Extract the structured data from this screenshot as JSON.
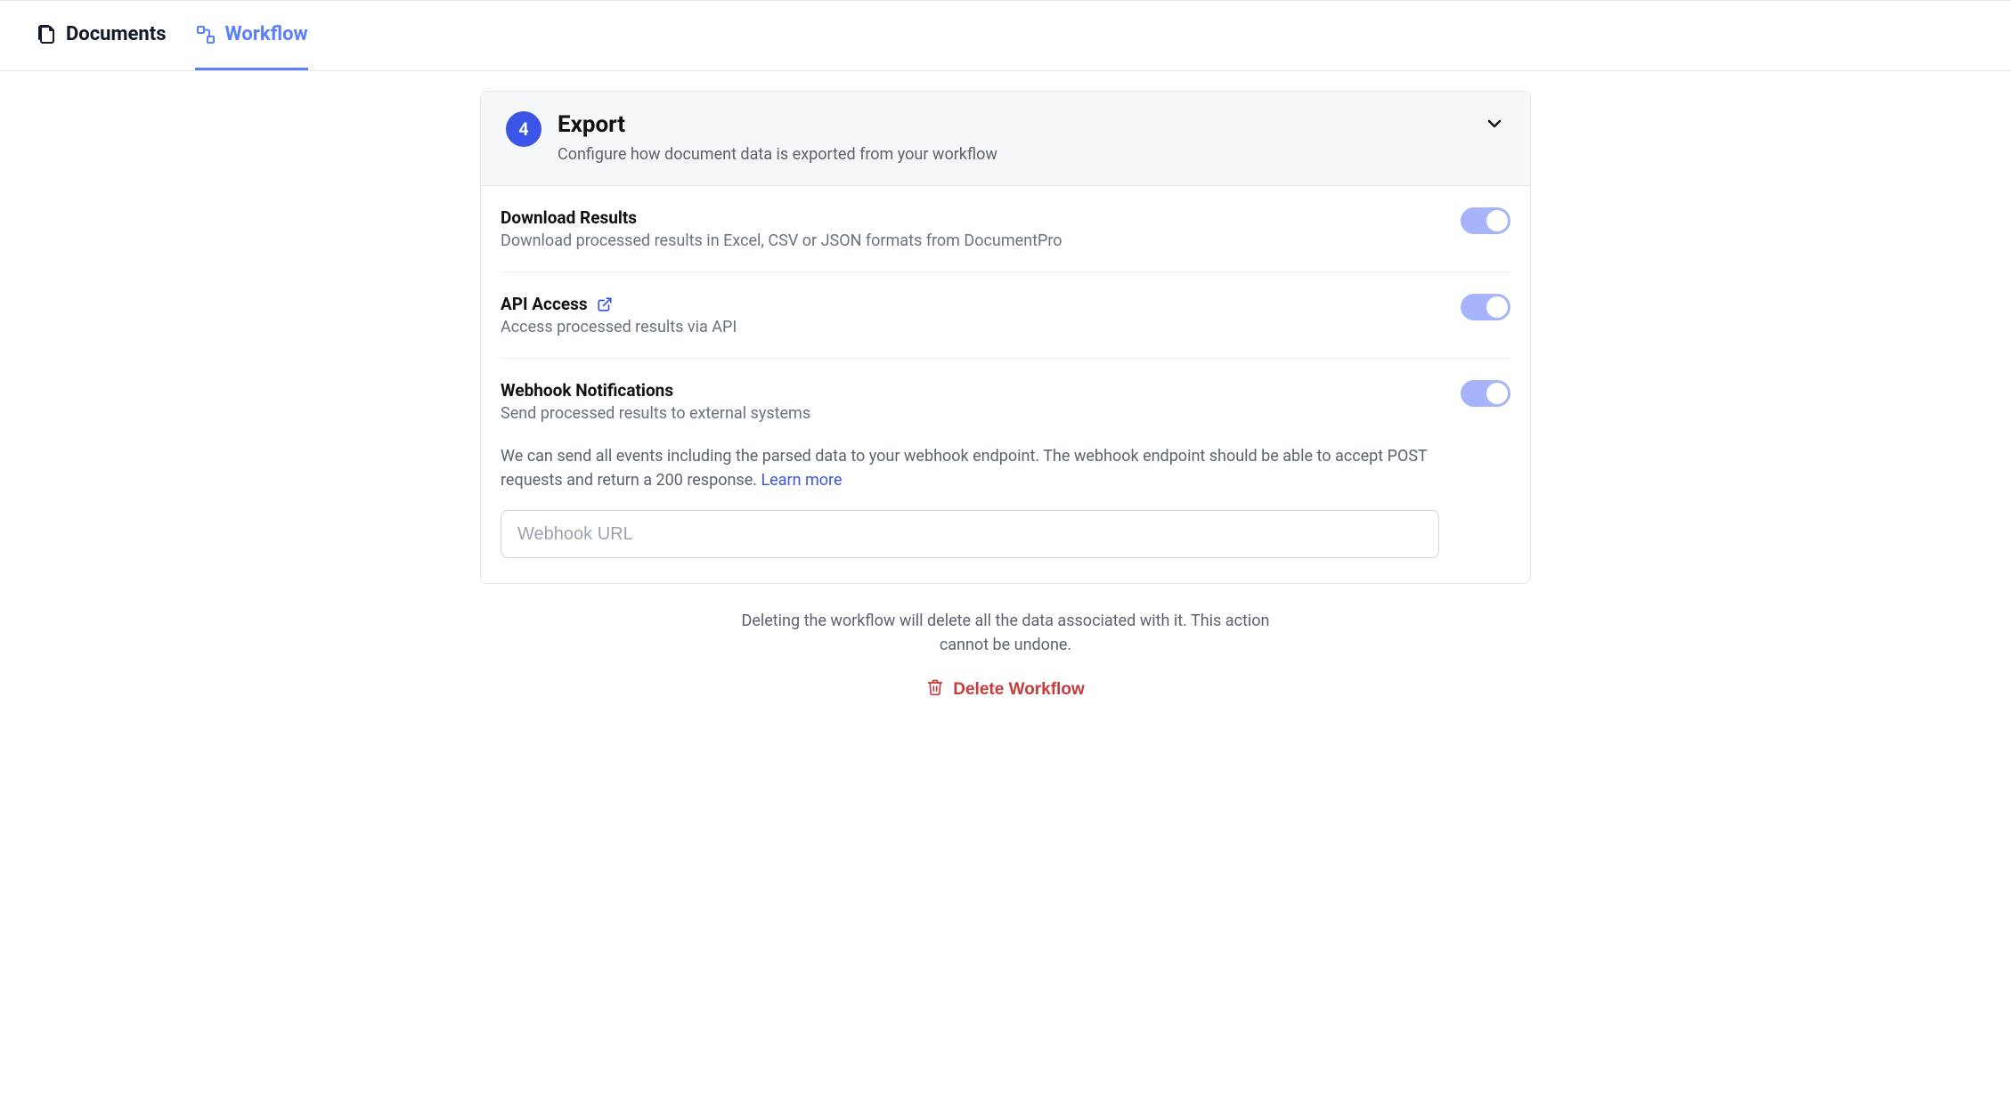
{
  "tabs": {
    "documents": "Documents",
    "workflow": "Workflow"
  },
  "panel": {
    "step": "4",
    "title": "Export",
    "subtitle": "Configure how document data is exported from your workflow"
  },
  "options": {
    "download": {
      "title": "Download Results",
      "desc": "Download processed results in Excel, CSV or JSON formats from DocumentPro"
    },
    "api": {
      "title": "API Access",
      "desc": "Access processed results via API"
    },
    "webhook": {
      "title": "Webhook Notifications",
      "desc": "Send processed results to external systems",
      "help": "We can send all events including the parsed data to your webhook endpoint. The webhook endpoint should be able to accept POST requests and return a 200 response. ",
      "learn_more": "Learn more",
      "placeholder": "Webhook URL"
    }
  },
  "delete": {
    "warning": "Deleting the workflow will delete all the data associated with it. This action cannot be undone.",
    "button": "Delete Workflow"
  }
}
